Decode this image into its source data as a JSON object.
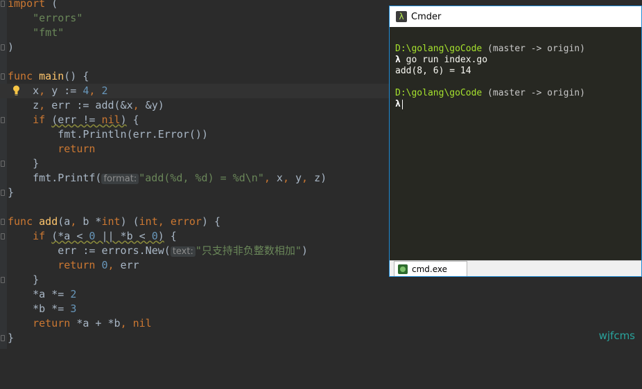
{
  "editor": {
    "lines": [
      "import (",
      "    \"errors\"",
      "    \"fmt\"",
      ")",
      "",
      "func main() {",
      "    x, y := 4, 2",
      "    z, err := add(&x, &y)",
      "    if (err != nil) {",
      "        fmt.Println(err.Error())",
      "        return",
      "    }",
      "    fmt.Printf(",
      "}",
      "",
      "func add(a, b *int) (int, error) {",
      "    if (*a < 0 || *b < 0) {",
      "        err := errors.New(",
      "        return 0, err",
      "    }",
      "    *a *= 2",
      "    *b *= 3",
      "    return *a + *b, nil",
      "}"
    ],
    "printf_hint": "format:",
    "printf_args": "\"add(%d, %d) = %d\\n\", x, y, z)",
    "new_hint": "text:",
    "new_args": "\"只支持非负整数相加\")"
  },
  "cmder": {
    "title": "Cmder",
    "lines": [
      {
        "path": "D:\\golang\\goCode",
        "git": " (master -> origin)"
      },
      {
        "prompt": "λ",
        "cmd": " go run index.go"
      },
      {
        "output": "add(8, 6) = 14"
      },
      {
        "path": "D:\\golang\\goCode",
        "git": " (master -> origin)"
      },
      {
        "prompt": "λ"
      }
    ],
    "tab_label": "cmd.exe"
  },
  "watermark": "wjfcms"
}
